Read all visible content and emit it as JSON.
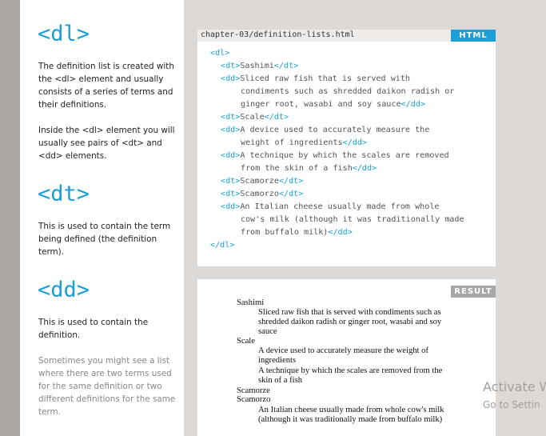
{
  "left": {
    "dl_heading": "<dl>",
    "dl_text_1": "The definition list is created with the <dl> element and usually consists of a series of terms and their definitions.",
    "dl_text_2": "Inside the <dl> element you will usually see pairs of <dt> and <dd> elements.",
    "dt_heading": "<dt>",
    "dt_text": "This is used to contain the term being defined (the definition term).",
    "dd_heading": "<dd>",
    "dd_text": "This is used to contain the definition.",
    "dd_note": "Sometimes you might see a list where there are two terms used for the same definition or two different definitions for the same term."
  },
  "code_panel": {
    "filename": "chapter-03/definition-lists.html",
    "tag": "HTML",
    "lines": {
      "l1": {
        "t1": "<dl>"
      },
      "l2": {
        "t1": "<dt>",
        "txt": "Sashimi",
        "t2": "</dt>"
      },
      "l3": {
        "t1": "<dd>",
        "txt": "Sliced raw fish that is served with"
      },
      "l4": {
        "txt": "condiments such as shredded daikon radish or"
      },
      "l5": {
        "txt": "ginger root, wasabi and soy sauce",
        "t2": "</dd>"
      },
      "l6": {
        "t1": "<dt>",
        "txt": "Scale",
        "t2": "</dt>"
      },
      "l7": {
        "t1": "<dd>",
        "txt": "A device used to accurately measure the"
      },
      "l8": {
        "txt": "weight of ingredients",
        "t2": "</dd>"
      },
      "l9": {
        "t1": "<dd>",
        "txt": "A technique by which the scales are removed"
      },
      "l10": {
        "txt": "from the skin of a fish",
        "t2": "</dd>"
      },
      "l11": {
        "t1": "<dt>",
        "txt": "Scamorze",
        "t2": "</dt>"
      },
      "l12": {
        "t1": "<dt>",
        "txt": "Scamorzo",
        "t2": "</dt>"
      },
      "l13": {
        "t1": "<dd>",
        "txt": "An Italian cheese usually made from whole"
      },
      "l14": {
        "txt": "cow's milk (although it was traditionally made"
      },
      "l15": {
        "txt": "from buffalo milk)",
        "t2": "</dd>"
      },
      "l16": {
        "t1": "</dl>"
      }
    }
  },
  "result_panel": {
    "tag": "RESULT",
    "r1": "Sashimi",
    "r2": "Sliced raw fish that is served with condiments such as",
    "r3": "shredded daikon radish or ginger root, wasabi and soy",
    "r4": "sauce",
    "r5": "Scale",
    "r6": "A device used to accurately measure the weight of",
    "r7": "ingredients",
    "r8": "A technique by which the scales are removed from the",
    "r9": "skin of a fish",
    "r10": "Scamorze",
    "r11": "Scamorzo",
    "r12": "An Italian cheese usually made from whole cow's milk",
    "r13": "(although it was traditionally made from buffalo milk)"
  },
  "watermark": {
    "line1": "Activate W",
    "line2": "Go to Settin"
  },
  "colors": {
    "accent": "#1b9fd6",
    "sidebar": "#a9a6a3",
    "panel_bg": "#ddd9d6"
  }
}
